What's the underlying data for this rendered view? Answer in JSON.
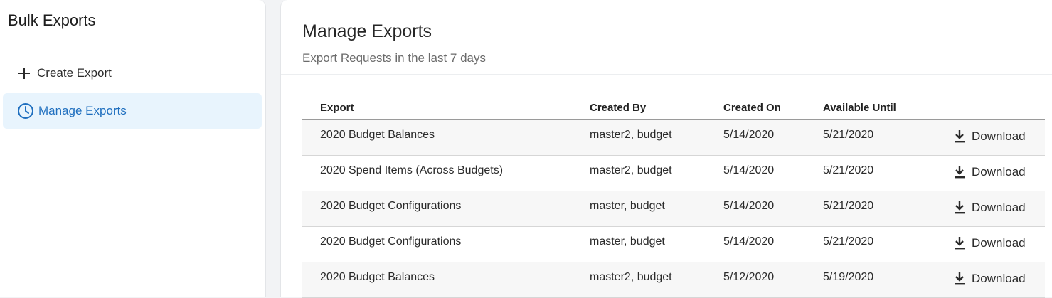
{
  "sidebar": {
    "title": "Bulk Exports",
    "items": [
      {
        "label": "Create Export",
        "icon": "plus-icon"
      },
      {
        "label": "Manage Exports",
        "icon": "clock-icon",
        "active": true
      }
    ]
  },
  "main": {
    "title": "Manage Exports",
    "subtitle": "Export Requests in the last 7 days",
    "table": {
      "headers": [
        "Export",
        "Created By",
        "Created On",
        "Available Until"
      ],
      "download_label": "Download",
      "rows": [
        {
          "export": "2020 Budget Balances",
          "created_by": "master2, budget",
          "created_on": "5/14/2020",
          "available_until": "5/21/2020"
        },
        {
          "export": "2020 Spend Items (Across Budgets)",
          "created_by": "master2, budget",
          "created_on": "5/14/2020",
          "available_until": "5/21/2020"
        },
        {
          "export": "2020 Budget Configurations",
          "created_by": "master, budget",
          "created_on": "5/14/2020",
          "available_until": "5/21/2020"
        },
        {
          "export": "2020 Budget Configurations",
          "created_by": "master, budget",
          "created_on": "5/14/2020",
          "available_until": "5/21/2020"
        },
        {
          "export": "2020 Budget Balances",
          "created_by": "master2, budget",
          "created_on": "5/12/2020",
          "available_until": "5/19/2020"
        }
      ]
    }
  },
  "colors": {
    "accent": "#1f6fbf",
    "active_bg": "#e8f4fd",
    "row_alt": "#f7f7f7"
  }
}
